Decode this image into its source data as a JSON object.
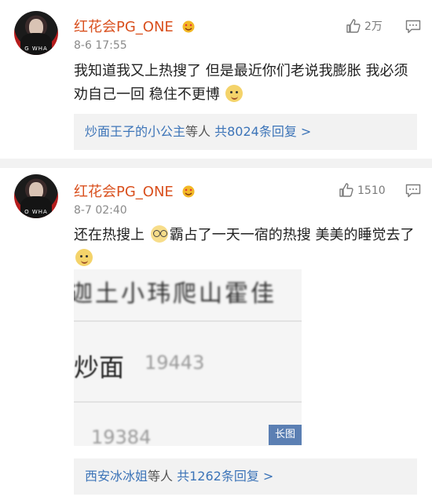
{
  "comments": [
    {
      "username": "红花会PG_ONE",
      "timestamp": "8-6 17:55",
      "likes": "2万",
      "text": "我知道我又上热搜了 但是最近你们老说我膨胀 我必须劝自己一回 稳住不更博",
      "reply_users": "炒面王子的小公主",
      "reply_etc": "等人",
      "reply_count": "共8024条回复 >"
    },
    {
      "username": "红花会PG_ONE",
      "timestamp": "8-7 02:40",
      "likes": "1510",
      "text_part1": "还在热搜上",
      "text_part2": "霸占了一天一宿的热搜   美美的睡觉去了",
      "image": {
        "line1": "迦土小玮爬山霍佳",
        "line2_name": "炒面",
        "line2_num": "19443",
        "line3_num": "19384",
        "tag": "长图"
      },
      "reply_users": "西安冰冰姐",
      "reply_etc": "等人",
      "reply_count": "共1262条回复 >"
    }
  ],
  "colors": {
    "username": "#d9501e",
    "link": "#3c74b8",
    "reply_bg": "#f2f2f2"
  }
}
